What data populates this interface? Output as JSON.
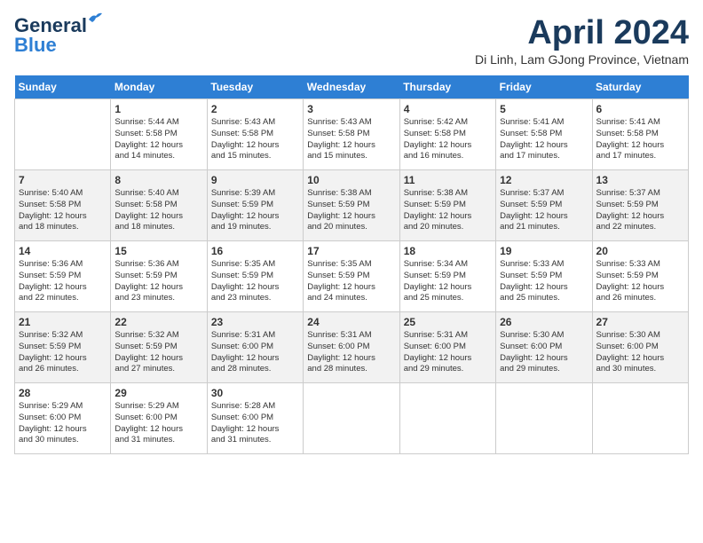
{
  "header": {
    "logo_line1": "General",
    "logo_line2": "Blue",
    "title": "April 2024",
    "location": "Di Linh, Lam GJong Province, Vietnam"
  },
  "weekdays": [
    "Sunday",
    "Monday",
    "Tuesday",
    "Wednesday",
    "Thursday",
    "Friday",
    "Saturday"
  ],
  "weeks": [
    [
      {
        "day": "",
        "info": ""
      },
      {
        "day": "1",
        "info": "Sunrise: 5:44 AM\nSunset: 5:58 PM\nDaylight: 12 hours\nand 14 minutes."
      },
      {
        "day": "2",
        "info": "Sunrise: 5:43 AM\nSunset: 5:58 PM\nDaylight: 12 hours\nand 15 minutes."
      },
      {
        "day": "3",
        "info": "Sunrise: 5:43 AM\nSunset: 5:58 PM\nDaylight: 12 hours\nand 15 minutes."
      },
      {
        "day": "4",
        "info": "Sunrise: 5:42 AM\nSunset: 5:58 PM\nDaylight: 12 hours\nand 16 minutes."
      },
      {
        "day": "5",
        "info": "Sunrise: 5:41 AM\nSunset: 5:58 PM\nDaylight: 12 hours\nand 17 minutes."
      },
      {
        "day": "6",
        "info": "Sunrise: 5:41 AM\nSunset: 5:58 PM\nDaylight: 12 hours\nand 17 minutes."
      }
    ],
    [
      {
        "day": "7",
        "info": "Sunrise: 5:40 AM\nSunset: 5:58 PM\nDaylight: 12 hours\nand 18 minutes."
      },
      {
        "day": "8",
        "info": "Sunrise: 5:40 AM\nSunset: 5:58 PM\nDaylight: 12 hours\nand 18 minutes."
      },
      {
        "day": "9",
        "info": "Sunrise: 5:39 AM\nSunset: 5:59 PM\nDaylight: 12 hours\nand 19 minutes."
      },
      {
        "day": "10",
        "info": "Sunrise: 5:38 AM\nSunset: 5:59 PM\nDaylight: 12 hours\nand 20 minutes."
      },
      {
        "day": "11",
        "info": "Sunrise: 5:38 AM\nSunset: 5:59 PM\nDaylight: 12 hours\nand 20 minutes."
      },
      {
        "day": "12",
        "info": "Sunrise: 5:37 AM\nSunset: 5:59 PM\nDaylight: 12 hours\nand 21 minutes."
      },
      {
        "day": "13",
        "info": "Sunrise: 5:37 AM\nSunset: 5:59 PM\nDaylight: 12 hours\nand 22 minutes."
      }
    ],
    [
      {
        "day": "14",
        "info": "Sunrise: 5:36 AM\nSunset: 5:59 PM\nDaylight: 12 hours\nand 22 minutes."
      },
      {
        "day": "15",
        "info": "Sunrise: 5:36 AM\nSunset: 5:59 PM\nDaylight: 12 hours\nand 23 minutes."
      },
      {
        "day": "16",
        "info": "Sunrise: 5:35 AM\nSunset: 5:59 PM\nDaylight: 12 hours\nand 23 minutes."
      },
      {
        "day": "17",
        "info": "Sunrise: 5:35 AM\nSunset: 5:59 PM\nDaylight: 12 hours\nand 24 minutes."
      },
      {
        "day": "18",
        "info": "Sunrise: 5:34 AM\nSunset: 5:59 PM\nDaylight: 12 hours\nand 25 minutes."
      },
      {
        "day": "19",
        "info": "Sunrise: 5:33 AM\nSunset: 5:59 PM\nDaylight: 12 hours\nand 25 minutes."
      },
      {
        "day": "20",
        "info": "Sunrise: 5:33 AM\nSunset: 5:59 PM\nDaylight: 12 hours\nand 26 minutes."
      }
    ],
    [
      {
        "day": "21",
        "info": "Sunrise: 5:32 AM\nSunset: 5:59 PM\nDaylight: 12 hours\nand 26 minutes."
      },
      {
        "day": "22",
        "info": "Sunrise: 5:32 AM\nSunset: 5:59 PM\nDaylight: 12 hours\nand 27 minutes."
      },
      {
        "day": "23",
        "info": "Sunrise: 5:31 AM\nSunset: 6:00 PM\nDaylight: 12 hours\nand 28 minutes."
      },
      {
        "day": "24",
        "info": "Sunrise: 5:31 AM\nSunset: 6:00 PM\nDaylight: 12 hours\nand 28 minutes."
      },
      {
        "day": "25",
        "info": "Sunrise: 5:31 AM\nSunset: 6:00 PM\nDaylight: 12 hours\nand 29 minutes."
      },
      {
        "day": "26",
        "info": "Sunrise: 5:30 AM\nSunset: 6:00 PM\nDaylight: 12 hours\nand 29 minutes."
      },
      {
        "day": "27",
        "info": "Sunrise: 5:30 AM\nSunset: 6:00 PM\nDaylight: 12 hours\nand 30 minutes."
      }
    ],
    [
      {
        "day": "28",
        "info": "Sunrise: 5:29 AM\nSunset: 6:00 PM\nDaylight: 12 hours\nand 30 minutes."
      },
      {
        "day": "29",
        "info": "Sunrise: 5:29 AM\nSunset: 6:00 PM\nDaylight: 12 hours\nand 31 minutes."
      },
      {
        "day": "30",
        "info": "Sunrise: 5:28 AM\nSunset: 6:00 PM\nDaylight: 12 hours\nand 31 minutes."
      },
      {
        "day": "",
        "info": ""
      },
      {
        "day": "",
        "info": ""
      },
      {
        "day": "",
        "info": ""
      },
      {
        "day": "",
        "info": ""
      }
    ]
  ]
}
